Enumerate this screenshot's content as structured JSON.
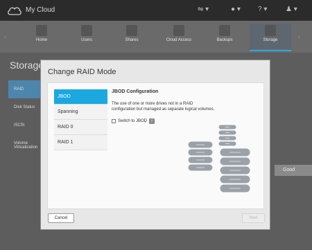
{
  "app": {
    "brand": "My Cloud"
  },
  "topbar": {
    "icons": [
      "usb-icon",
      "bell-icon",
      "help-icon",
      "user-icon"
    ]
  },
  "nav": {
    "items": [
      {
        "label": "Home",
        "icon": "home-icon"
      },
      {
        "label": "Users",
        "icon": "users-icon"
      },
      {
        "label": "Shares",
        "icon": "shares-icon"
      },
      {
        "label": "Cloud Access",
        "icon": "cloud-access-icon"
      },
      {
        "label": "Backups",
        "icon": "backups-icon"
      },
      {
        "label": "Storage",
        "icon": "storage-icon",
        "active": true
      }
    ]
  },
  "page": {
    "title": "Storage",
    "sidebar": [
      "RAID",
      "Disk Status",
      "iSCSI",
      "Volume Virtualization"
    ],
    "status": "Good"
  },
  "modal": {
    "title": "Change RAID Mode",
    "raid_modes": [
      "JBOD",
      "Spanning",
      "RAID 0",
      "RAID 1"
    ],
    "selected": "JBOD",
    "detail": {
      "title": "JBOD Configuration",
      "description": "The use of one or more drives not in a RAID configuration but managed as separate logical volumes.",
      "switch_label": "Switch to JBOD",
      "switch_checked": false
    },
    "cancel_label": "Cancel",
    "next_label": "Next"
  },
  "colors": {
    "accent": "#1ba8e0",
    "drive_gray": "#9aa1a8"
  }
}
